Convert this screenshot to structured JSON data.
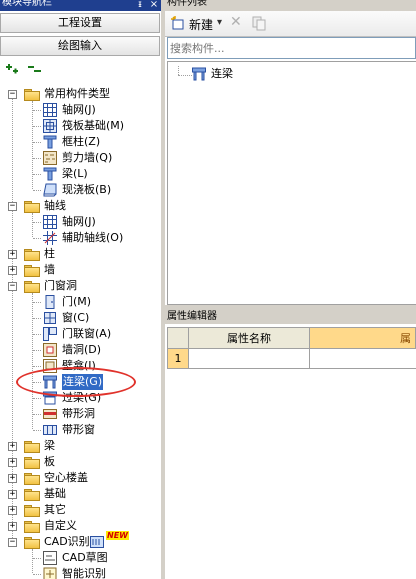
{
  "left_panel": {
    "title": "模块导航栏",
    "pin_glyph": "ᵻ",
    "close_glyph": "×",
    "buttons": {
      "project_settings": "工程设置",
      "drawing_input": "绘图输入"
    },
    "toolbar": {
      "expand_glyph": "+",
      "collapse_glyph": "−"
    }
  },
  "tree": {
    "group_common": "常用构件类型",
    "common_items": [
      "轴网(J)",
      "筏板基础(M)",
      "框柱(Z)",
      "剪力墙(Q)",
      "梁(L)",
      "现浇板(B)"
    ],
    "group_axis": "轴线",
    "axis_items": [
      "轴网(J)",
      "辅助轴线(O)"
    ],
    "group_column": "柱",
    "group_wall": "墙",
    "group_openings": "门窗洞",
    "opening_items": [
      "门(M)",
      "窗(C)",
      "门联窗(A)",
      "墙洞(D)",
      "壁龛(I)",
      "连梁(G)",
      "过梁(G)",
      "带形洞",
      "带形窗"
    ],
    "groups_after": [
      "梁",
      "板",
      "空心楼盖",
      "基础",
      "其它",
      "自定义"
    ],
    "group_cad": "CAD识别",
    "cad_badge": "NEW",
    "cad_items": [
      "CAD草图",
      "智能识别"
    ]
  },
  "component_list": {
    "title": "构件列表",
    "new_button": "新建",
    "dropdown_glyph": "▾",
    "delete_glyph": "✕",
    "search_placeholder": "搜索构件...",
    "items": [
      "连梁"
    ]
  },
  "property_editor": {
    "title": "属性编辑器",
    "columns": [
      "属性名称",
      "属"
    ],
    "rows": [
      {
        "num": "1",
        "name": "",
        "value": ""
      }
    ]
  },
  "colors": {
    "highlight_oval": "#e0322b",
    "title_blue": "#1f3f8f",
    "grid_header_yellow": "#ffd98a"
  }
}
